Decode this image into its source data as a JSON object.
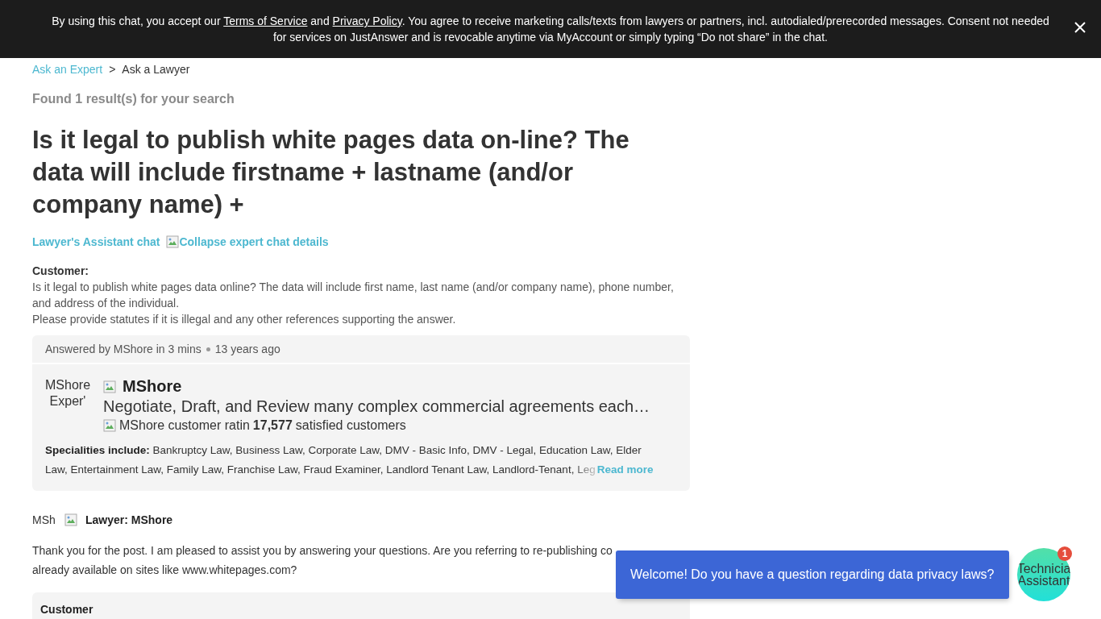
{
  "consent_banner": {
    "parts": [
      "By using this chat, you accept our ",
      "Terms of Service",
      " and ",
      "Privacy Policy",
      ". You agree to receive marketing calls/texts from lawyers or partners, incl. autodialed/prerecorded messages. Consent not needed for services on JustAnswer and is revocable anytime via MyAccount or simply typing “Do not share” in the chat."
    ]
  },
  "breadcrumb": [
    {
      "label": "Ask an Expert",
      "kind": "link"
    },
    {
      "label": ">",
      "kind": "separator"
    },
    {
      "label": "Ask a Lawyer",
      "kind": "current"
    }
  ],
  "result_count": "Found 1 result(s) for your search",
  "question_title": "Is it legal to publish white pages data on-line? The data will include firstname + lastname (and/or company name) +",
  "chat_links": [
    {
      "label": "Lawyer's Assistant chat",
      "kind": "text"
    },
    {
      "label": "Collapse expert chat details",
      "kind": "image"
    }
  ],
  "customer_post": {
    "label": "Customer:",
    "lines": [
      "Is it legal to publish white pages data online? The data will include first name, last name (and/or company name), phone number, and address of the individual.",
      "Please provide statutes if it is illegal and any other references supporting the answer."
    ]
  },
  "expert_card": {
    "answered_by": "Answered by MShore in 3 mins",
    "age": "13 years ago",
    "avatar_alt": [
      "MShore",
      "Exper'"
    ],
    "name": "MShore",
    "headline": "Negotiate, Draft, and Review many complex commercial agreements each…",
    "rating_alt": "MShore customer ratin",
    "satisfied_count": "17,577",
    "satisfied_label": "satisfied customers",
    "specialities_label": "Specialities include:",
    "specialities": [
      "Bankruptcy Law, Business Law, Corporate Law, DMV - Basic Info, DMV - Legal, Education Law, Elder",
      "Law, Entertainment Law, Family Law, Franchise Law, Fraud Examiner, Landlord Tenant Law, Landlord-Tenant, Leg"
    ],
    "read_more": "Read more"
  },
  "answer": {
    "avatar_alt": "MSh",
    "author": "Lawyer: MShore",
    "lines": [
      "Thank you for the post. I am pleased to assist you by answering your questions. Are you referring to re-publishing co",
      "already available on sites like www.whitepages.com?"
    ]
  },
  "next_post": {
    "label": "Customer"
  },
  "chat_widget": {
    "message": "Welcome! Do you have a question regarding data privacy laws?",
    "avatar_alt": [
      "Technicia",
      "Assistant"
    ],
    "badge": "1"
  }
}
